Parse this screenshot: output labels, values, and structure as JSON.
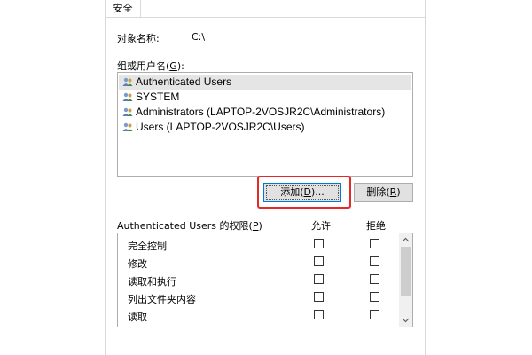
{
  "tab": {
    "label": "安全"
  },
  "object": {
    "label": "对象名称:",
    "value": "C:\\"
  },
  "groups": {
    "label_prefix": "组或用户名(",
    "label_key": "G",
    "label_suffix": "):",
    "items": [
      {
        "name": "Authenticated Users",
        "selected": true
      },
      {
        "name": "SYSTEM",
        "selected": false
      },
      {
        "name": "Administrators (LAPTOP-2VOSJR2C\\Administrators)",
        "selected": false
      },
      {
        "name": "Users (LAPTOP-2VOSJR2C\\Users)",
        "selected": false
      }
    ]
  },
  "buttons": {
    "add": {
      "prefix": "添加(",
      "key": "D",
      "suffix": ")..."
    },
    "remove": {
      "prefix": "删除(",
      "key": "R",
      "suffix": ")"
    }
  },
  "permissions": {
    "label_prefix": "Authenticated Users 的权限(",
    "label_key": "P",
    "label_suffix": ")",
    "allow_header": "允许",
    "deny_header": "拒绝",
    "items": [
      {
        "name": "完全控制",
        "allow": false,
        "deny": false
      },
      {
        "name": "修改",
        "allow": false,
        "deny": false
      },
      {
        "name": "读取和执行",
        "allow": false,
        "deny": false
      },
      {
        "name": "列出文件夹内容",
        "allow": false,
        "deny": false
      },
      {
        "name": "读取",
        "allow": false,
        "deny": false
      }
    ]
  },
  "colors": {
    "highlight": "#e52828",
    "selection": "#e5e5e5",
    "focus": "#0078d7"
  }
}
